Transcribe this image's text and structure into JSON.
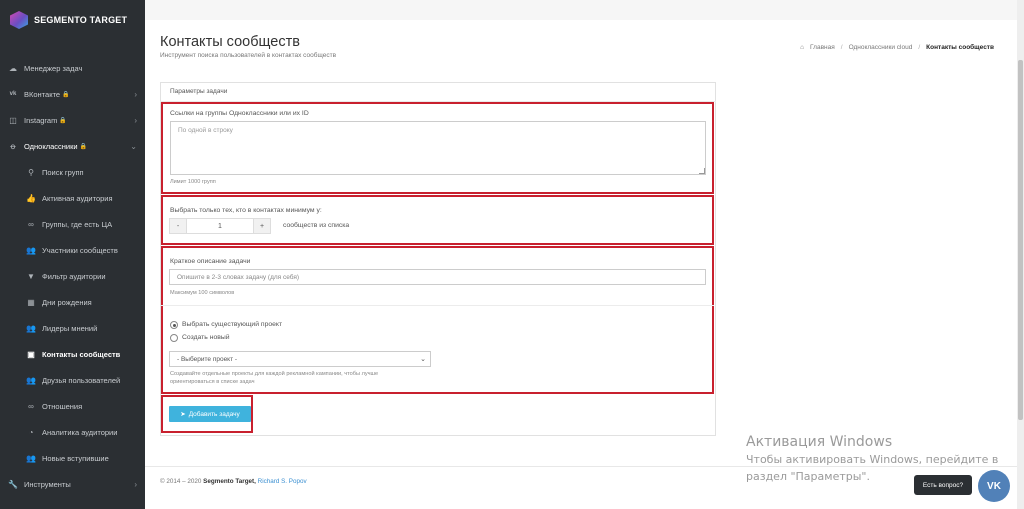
{
  "app": {
    "logo_text": "SEGMENTO TARGET"
  },
  "sidebar": {
    "items": [
      {
        "label": "Менеджер задач",
        "icon": "cloud-icon"
      },
      {
        "label": "ВКонтакте",
        "icon": "vk-icon",
        "lock": "🔒",
        "chevron": "›"
      },
      {
        "label": "Instagram",
        "icon": "instagram-icon",
        "lock": "🔒",
        "chevron": "›"
      },
      {
        "label": "Одноклассники",
        "icon": "ok-icon",
        "lock": "🔒",
        "chevron": "⌄"
      }
    ],
    "subitems": [
      {
        "label": "Поиск групп",
        "icon": "search-icon"
      },
      {
        "label": "Активная аудитория",
        "icon": "thumbs-up-icon"
      },
      {
        "label": "Группы, где есть ЦА",
        "icon": "link-icon"
      },
      {
        "label": "Участники сообществ",
        "icon": "users-icon"
      },
      {
        "label": "Фильтр аудитории",
        "icon": "filter-icon"
      },
      {
        "label": "Дни рождения",
        "icon": "calendar-icon"
      },
      {
        "label": "Лидеры мнений",
        "icon": "users-icon"
      },
      {
        "label": "Контакты сообществ",
        "icon": "contact-card-icon"
      },
      {
        "label": "Друзья пользователей",
        "icon": "users-icon"
      },
      {
        "label": "Отношения",
        "icon": "link-icon"
      },
      {
        "label": "Аналитика аудитории",
        "icon": "analytics-icon"
      },
      {
        "label": "Новые вступившие",
        "icon": "users-icon"
      },
      {
        "label": "Инструменты",
        "icon": "wrench-icon",
        "chevron": "›"
      }
    ]
  },
  "header": {
    "title": "Контакты сообществ",
    "subtitle": "Инструмент поиска пользователей в контактах сообществ",
    "breadcrumb": {
      "home": "Главная",
      "section": "Одноклассники cloud",
      "current": "Контакты сообществ"
    }
  },
  "form": {
    "panel_title": "Параметры задачи",
    "groups_label": "Ссылки на группы Одноклассники или их ID",
    "groups_placeholder": "По одной в строку",
    "groups_hint": "Лимит 1000 групп",
    "min_contacts_label": "Выбрать только тех, кто в контактах минимум у:",
    "stepper_minus": "-",
    "stepper_value": "1",
    "stepper_plus": "+",
    "stepper_suffix": "сообществ из списка",
    "desc_label": "Краткое описание задачи",
    "desc_placeholder": "Опишите в 2-3 словах задачу (для себя)",
    "desc_hint": "Максимум 100 символов",
    "radio_existing": "Выбрать существующий проект",
    "radio_new": "Создать новый",
    "project_select": "- Выберите проект -",
    "project_hint_1": "Создавайте отдельные проекты для каждой рекламной кампании, чтобы лучше",
    "project_hint_2": "ориентироваться в списке задач",
    "submit": "Добавить задачу"
  },
  "footer": {
    "copyright": "© 2014 – 2020",
    "brand": "Segmento Target,",
    "author": "Richard S. Popov"
  },
  "watermark": {
    "line1": "Активация Windows",
    "line2": "Чтобы активировать Windows, перейдите в",
    "line3": "раздел \"Параметры\"."
  },
  "help": {
    "bubble": "Есть вопрос?",
    "vk": "VK"
  }
}
